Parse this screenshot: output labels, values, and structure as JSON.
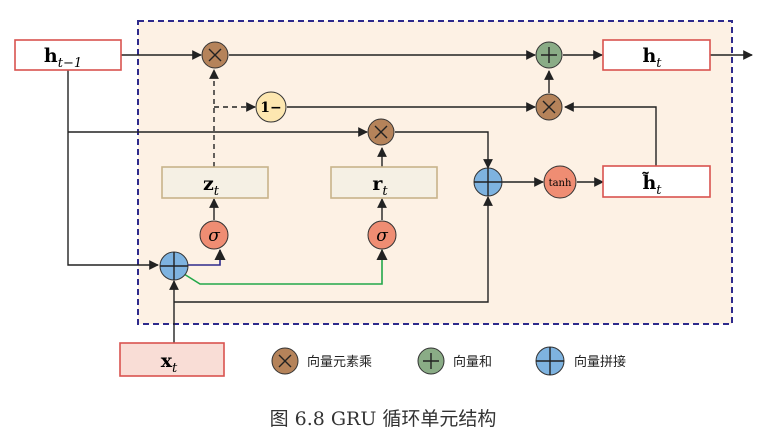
{
  "labels": {
    "h_prev": {
      "main": "h",
      "sub": "t−1"
    },
    "h_t": {
      "main": "h",
      "sub": "t"
    },
    "h_tilde": {
      "main": "h̃",
      "sub": "t"
    },
    "z_t": {
      "main": "z",
      "sub": "t"
    },
    "r_t": {
      "main": "r",
      "sub": "t"
    },
    "x_t": {
      "main": "x",
      "sub": "t"
    },
    "one_minus": "1−",
    "tanh": "tanh",
    "sigma": "σ"
  },
  "legend": [
    {
      "icon": "multiply-icon",
      "text": "向量元素乘"
    },
    {
      "icon": "add-icon",
      "text": "向量和"
    },
    {
      "icon": "concat-icon",
      "text": "向量拼接"
    }
  ],
  "caption": "图 6.8 GRU 循环单元结构",
  "colors": {
    "panel_fill": "#fdf1e4",
    "panel_border": "#2e2a8c",
    "box_red": "#d9534f",
    "box_red_fill": "#f9ddd6",
    "box_tan": "#c8b38a",
    "box_tan_fill": "#f5f0e4",
    "multiply": "#b5835a",
    "add": "#8aac86",
    "concat": "#7eb3e0",
    "sigma_tanh": "#ef8d73",
    "one_minus": "#fde7b0",
    "blue_line": "#2e2a8c",
    "green_line": "#23a84a"
  }
}
